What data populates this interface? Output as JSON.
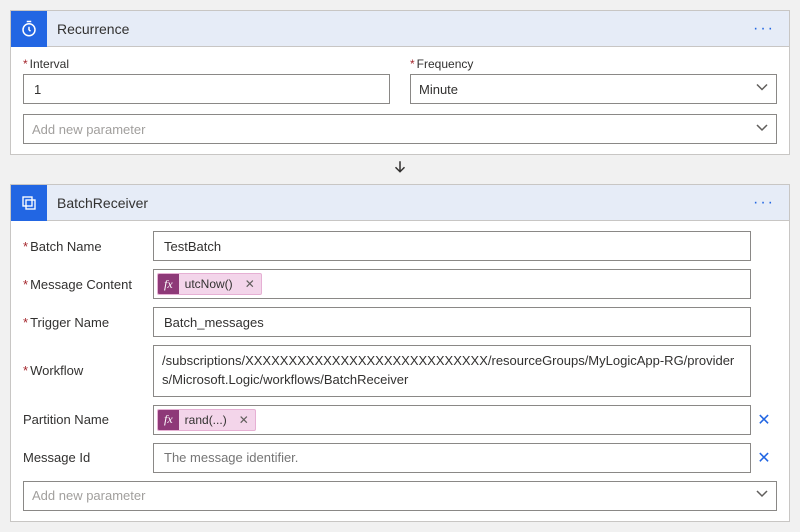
{
  "recurrence": {
    "title": "Recurrence",
    "interval_label": "Interval",
    "interval_value": "1",
    "frequency_label": "Frequency",
    "frequency_value": "Minute",
    "add_param": "Add new parameter"
  },
  "batch": {
    "title": "BatchReceiver",
    "rows": {
      "batch_name": {
        "label": "Batch Name",
        "value": "TestBatch"
      },
      "message_content": {
        "label": "Message Content",
        "token": "utcNow()"
      },
      "trigger_name": {
        "label": "Trigger Name",
        "value": "Batch_messages"
      },
      "workflow": {
        "label": "Workflow",
        "value": "/subscriptions/XXXXXXXXXXXXXXXXXXXXXXXXXXXX/resourceGroups/MyLogicApp-RG/providers/Microsoft.Logic/workflows/BatchReceiver"
      },
      "partition_name": {
        "label": "Partition Name",
        "token": "rand(...)"
      },
      "message_id": {
        "label": "Message Id",
        "placeholder": "The message identifier."
      }
    },
    "add_param": "Add new parameter"
  },
  "fx_label": "fx"
}
